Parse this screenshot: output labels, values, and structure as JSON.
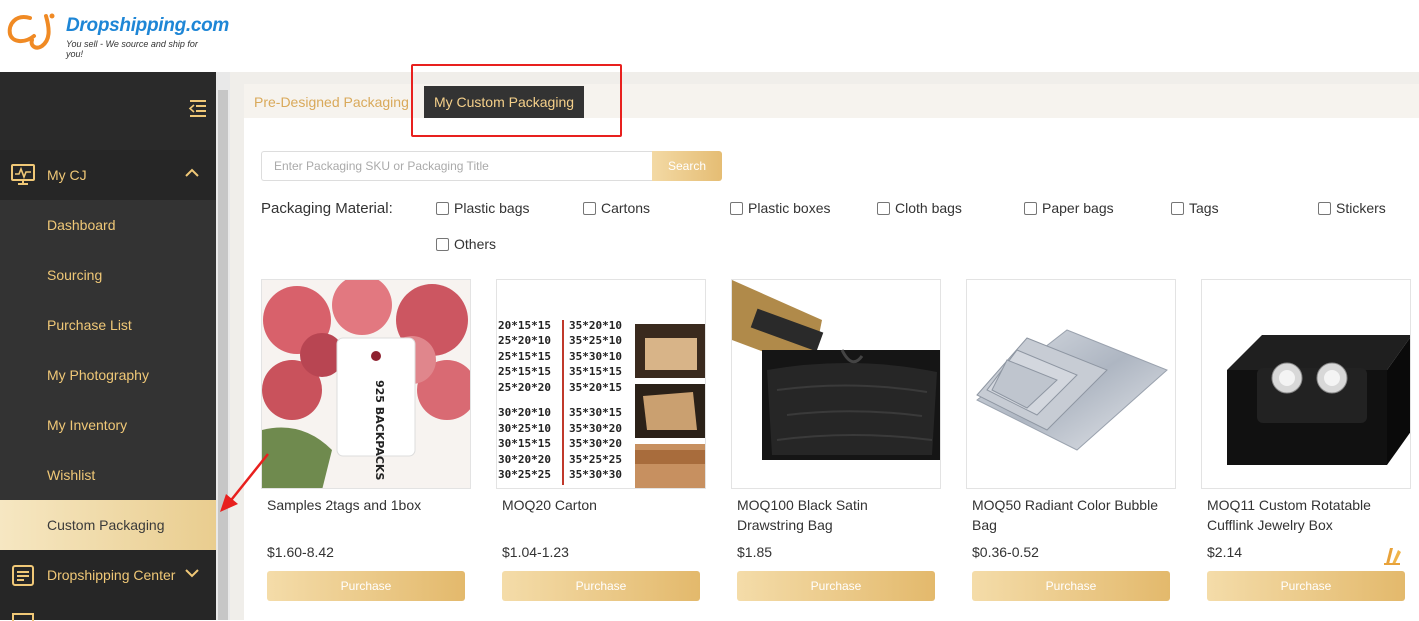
{
  "brand": {
    "name": "Dropshipping.com",
    "tagline": "You sell - We source and ship for you!",
    "mark": "CJ",
    "accent": "#1e86d6"
  },
  "sidebar": {
    "collapse_icon": "menu-collapse-icon",
    "items": [
      {
        "label": "My CJ",
        "icon": "monitor-chart-icon",
        "expanded": true
      },
      {
        "label": "Dashboard"
      },
      {
        "label": "Sourcing"
      },
      {
        "label": "Purchase List"
      },
      {
        "label": "My Photography"
      },
      {
        "label": "My Inventory"
      },
      {
        "label": "Wishlist"
      },
      {
        "label": "Custom Packaging",
        "active": true
      },
      {
        "label": "Dropshipping Center",
        "icon": "clipboard-list-icon",
        "expanded": false
      }
    ]
  },
  "tabs": {
    "predesigned": "Pre-Designed Packaging",
    "custom": "My Custom Packaging",
    "active": "custom"
  },
  "search": {
    "placeholder": "Enter Packaging SKU or Packaging Title",
    "button": "Search"
  },
  "filters": {
    "label": "Packaging Material:",
    "options": [
      "Plastic bags",
      "Cartons",
      "Plastic boxes",
      "Cloth bags",
      "Paper bags",
      "Tags",
      "Stickers",
      "Others"
    ]
  },
  "tag_text": "925 BACKPACKS",
  "carton_sizes": {
    "left": [
      "20*15*15",
      "25*20*10",
      "25*15*15",
      "25*15*15",
      "25*20*20",
      "30*20*10",
      "30*25*10",
      "30*15*15",
      "30*20*20",
      "30*25*25"
    ],
    "right": [
      "35*20*10",
      "35*25*10",
      "35*30*10",
      "35*15*15",
      "35*20*15",
      "35*30*15",
      "35*30*20",
      "35*30*20",
      "35*25*25",
      "35*30*30"
    ]
  },
  "products": [
    {
      "title": "Samples 2tags and 1box",
      "price": "$1.60-8.42",
      "button": "Purchase"
    },
    {
      "title": "MOQ20 Carton",
      "price": "$1.04-1.23",
      "button": "Purchase"
    },
    {
      "title": "MOQ100 Black Satin Drawstring Bag",
      "price": "$1.85",
      "button": "Purchase"
    },
    {
      "title": "MOQ50 Radiant Color Bubble Bag",
      "price": "$0.36-0.52",
      "button": "Purchase"
    },
    {
      "title": "MOQ11 Custom Rotatable Cufflink Jewelry Box",
      "price": "$2.14",
      "button": "Purchase"
    }
  ],
  "colors": {
    "gold": "#e5bd74",
    "sidebar": "#2a2a2a",
    "highlight": "#e8201e"
  }
}
